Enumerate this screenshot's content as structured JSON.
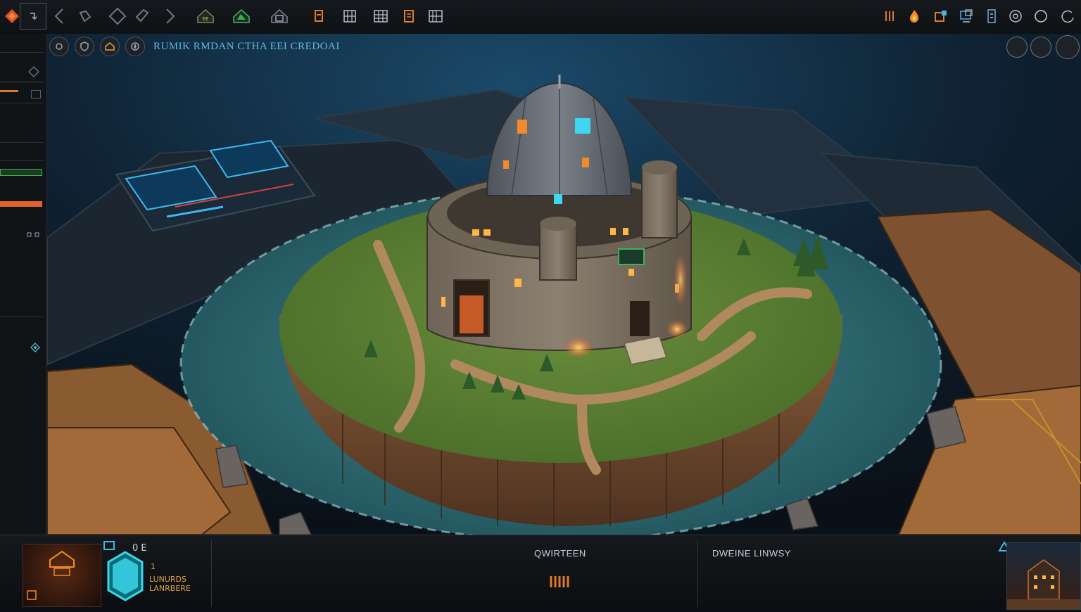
{
  "header": {
    "title": "RUMIK RMDAN CTHA EEI CREDOAI"
  },
  "bottom": {
    "unit_code": "0 E",
    "unit_count": "1",
    "unit_line1": "LUNURDS",
    "unit_line2": "LANRBERE",
    "center_title": "QWIRTEEN",
    "right_title": "DWEINE LINWSY"
  },
  "colors": {
    "accent_orange": "#e07a2a",
    "accent_cyan": "#3fd6e8",
    "accent_green": "#3fae4a",
    "panel_bg": "#111417"
  }
}
